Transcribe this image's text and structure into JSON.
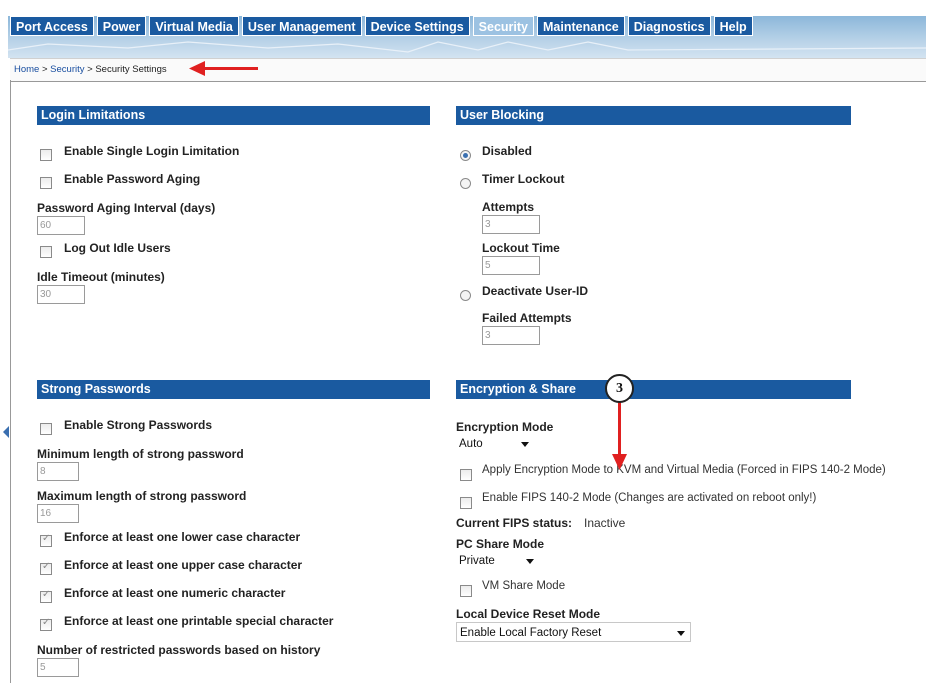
{
  "menu": {
    "items": [
      {
        "label": "Port Access",
        "active": false
      },
      {
        "label": "Power",
        "active": false
      },
      {
        "label": "Virtual Media",
        "active": false
      },
      {
        "label": "User Management",
        "active": false
      },
      {
        "label": "Device Settings",
        "active": false
      },
      {
        "label": "Security",
        "active": true
      },
      {
        "label": "Maintenance",
        "active": false
      },
      {
        "label": "Diagnostics",
        "active": false
      },
      {
        "label": "Help",
        "active": false
      }
    ]
  },
  "breadcrumb": {
    "home": "Home",
    "sep1": " > ",
    "security": "Security",
    "sep2": " > ",
    "current": "Security Settings"
  },
  "login": {
    "title": "Login Limitations",
    "single_login": "Enable Single Login Limitation",
    "password_aging": "Enable Password Aging",
    "aging_interval_label": "Password Aging Interval (days)",
    "aging_interval_value": "60",
    "logout_idle": "Log Out Idle Users",
    "idle_timeout_label": "Idle Timeout (minutes)",
    "idle_timeout_value": "30"
  },
  "blocking": {
    "title": "User Blocking",
    "disabled": "Disabled",
    "timer_lockout": "Timer Lockout",
    "attempts_label": "Attempts",
    "attempts_value": "3",
    "lockout_time_label": "Lockout Time",
    "lockout_time_value": "5",
    "deactivate": "Deactivate User-ID",
    "failed_attempts_label": "Failed Attempts",
    "failed_attempts_value": "3"
  },
  "strong": {
    "title": "Strong Passwords",
    "enable": "Enable Strong Passwords",
    "min_label": "Minimum length of strong password",
    "min_value": "8",
    "max_label": "Maximum length of strong password",
    "max_value": "16",
    "lower": "Enforce at least one lower case character",
    "upper": "Enforce at least one upper case character",
    "numeric": "Enforce at least one numeric character",
    "special": "Enforce at least one printable special character",
    "history_label": "Number of restricted passwords based on history",
    "history_value": "5"
  },
  "encryption": {
    "title": "Encryption & Share",
    "mode_label": "Encryption Mode",
    "mode_value": "Auto",
    "apply_kvm": "Apply Encryption Mode to KVM and Virtual Media (Forced in FIPS 140-2 Mode)",
    "enable_fips": "Enable FIPS 140-2 Mode (Changes are activated on reboot only!)",
    "fips_status_label": "Current FIPS status:",
    "fips_status_value": "Inactive",
    "pc_share_label": "PC Share Mode",
    "pc_share_value": "Private",
    "vm_share": "VM Share Mode",
    "reset_label": "Local Device Reset Mode",
    "reset_value": "Enable Local Factory Reset"
  },
  "callout": {
    "number": "3"
  },
  "colors": {
    "header_blue": "#1a5aa0",
    "active_tab": "#9cc2e2",
    "annotation_red": "#e02020"
  }
}
